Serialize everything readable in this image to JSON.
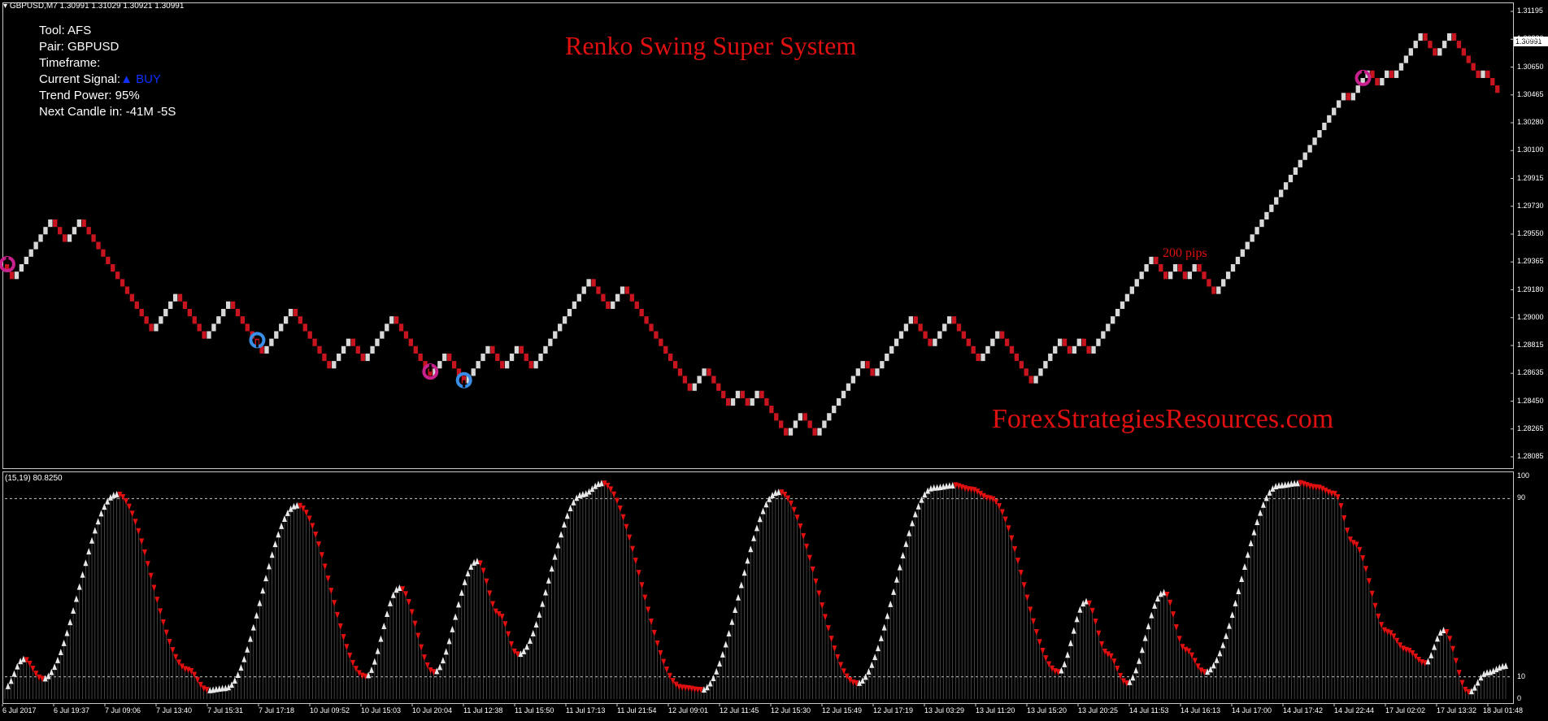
{
  "symbol_bar": "GBPUSD,M7  1.30991 1.31029 1.30921 1.30991",
  "info": {
    "tool": "Tool: AFS",
    "pair": "Pair: GBPUSD",
    "timeframe": "Timeframe:",
    "signal_label": "Current Signal:",
    "signal_arrow": "▲",
    "signal_value": "BUY",
    "trend_power": "Trend Power: 95%",
    "next_candle": "Next Candle in: -41M -5S"
  },
  "title": "Renko Swing Super System",
  "watermark": "ForexStrategiesResources.com",
  "pips_note": "200 pips",
  "current_price": "1.30991",
  "price_ticks": [
    "1.31195",
    "1.30830",
    "1.30650",
    "1.30465",
    "1.30280",
    "1.30100",
    "1.29915",
    "1.29730",
    "1.29550",
    "1.29365",
    "1.29180",
    "1.29000",
    "1.28815",
    "1.28635",
    "1.28450",
    "1.28265",
    "1.28085"
  ],
  "osc_label": "(15,19) 80.8250",
  "osc_ticks": [
    "100",
    "90",
    "10",
    "0"
  ],
  "time_ticks": [
    "6 Jul 2017",
    "6 Jul 19:37",
    "7 Jul 09:06",
    "7 Jul 13:40",
    "7 Jul 15:31",
    "7 Jul 17:18",
    "10 Jul 09:52",
    "10 Jul 15:03",
    "10 Jul 20:04",
    "11 Jul 12:38",
    "11 Jul 15:50",
    "11 Jul 17:13",
    "11 Jul 21:54",
    "12 Jul 09:01",
    "12 Jul 11:45",
    "12 Jul 15:30",
    "12 Jul 15:49",
    "12 Jul 17:19",
    "13 Jul 03:29",
    "13 Jul 11:20",
    "13 Jul 15:20",
    "13 Jul 20:25",
    "14 Jul 11:53",
    "14 Jul 16:13",
    "14 Jul 17:00",
    "14 Jul 17:42",
    "14 Jul 22:44",
    "17 Jul 02:02",
    "17 Jul 13:32",
    "18 Jul 01:48"
  ],
  "colors": {
    "bull_brick": "#d8d8d8",
    "bear_brick": "#c8141e",
    "buy_marker": "#3a8ee6",
    "sell_marker": "#c8208c",
    "title_red": "#e01010",
    "grid_dash": "#c8c8c8"
  },
  "chart_data": {
    "type": "renko",
    "price_ylim": [
      1.28085,
      1.31195
    ],
    "brick_path_note": "price swings of the renko series (approximate, in price units)",
    "swings": [
      1.2943,
      1.2932,
      1.2974,
      1.296,
      1.2972,
      1.2897,
      1.2922,
      1.2891,
      1.2916,
      1.2883,
      1.2912,
      1.2872,
      1.2889,
      1.2873,
      1.2906,
      1.2864,
      1.2883,
      1.286,
      1.2885,
      1.2868,
      1.2885,
      1.2868,
      1.2877,
      1.2935,
      1.2912,
      1.2928,
      1.2855,
      1.2869,
      1.2844,
      1.2856,
      1.2843,
      1.2855,
      1.2822,
      1.2841,
      1.2821,
      1.2873,
      1.2864,
      1.2906,
      1.2885,
      1.2906,
      1.2875,
      1.2894,
      1.2862,
      1.2891,
      1.288,
      1.2891,
      1.288,
      1.295,
      1.2931,
      1.2945,
      1.2931,
      1.2945,
      1.2923,
      1.2938,
      1.2957,
      1.3065,
      1.3057,
      1.3079,
      1.3068,
      1.3079,
      1.3071,
      1.3105,
      1.3087,
      1.3105,
      1.3072,
      1.3078,
      1.306
    ],
    "markers": [
      {
        "type": "sell",
        "price": 1.2943
      },
      {
        "type": "buy",
        "price": 1.289
      },
      {
        "type": "sell",
        "price": 1.2868
      },
      {
        "type": "buy",
        "price": 1.2862
      },
      {
        "type": "sell",
        "price": 1.3073
      }
    ],
    "oscillator": {
      "label": "(15,19) 80.8250",
      "ylim": [
        0,
        100
      ],
      "levels": [
        90,
        10
      ],
      "swings": [
        5,
        18,
        9,
        92,
        13,
        4,
        5,
        87,
        10,
        50,
        12,
        62,
        38,
        20,
        92,
        97,
        5,
        4,
        93,
        7,
        95,
        96,
        94,
        90,
        12,
        44,
        20,
        7,
        48,
        22,
        12,
        96,
        97,
        95,
        92,
        70,
        30,
        22,
        16,
        31,
        3,
        12,
        15
      ]
    }
  }
}
